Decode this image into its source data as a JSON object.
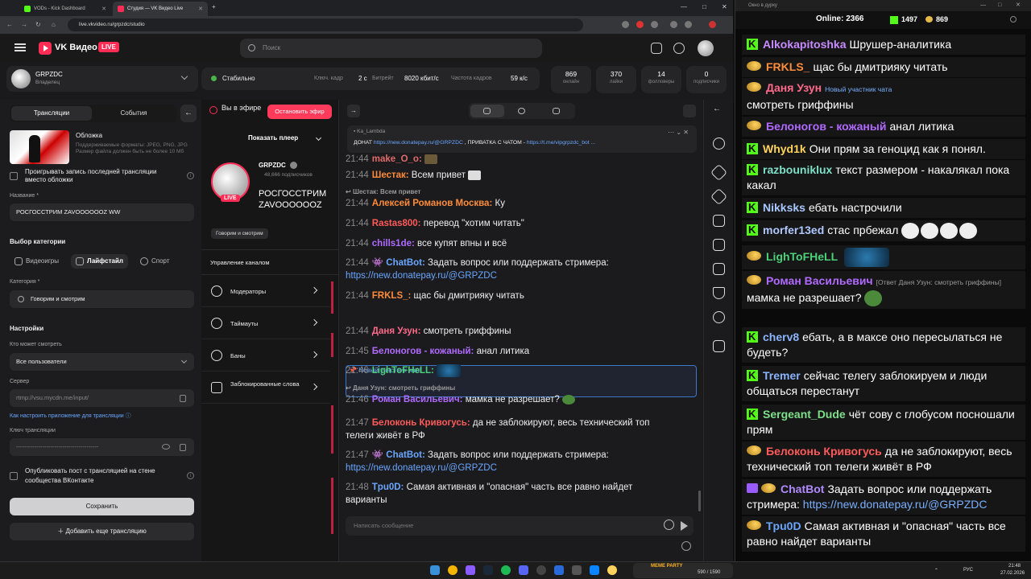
{
  "browser": {
    "tabs": [
      {
        "label": "VODs - Kick Dashboard"
      },
      {
        "label": "Студия — VK Видео Live"
      }
    ],
    "url": "live.vkvideo.ru/grpzdc/studio"
  },
  "header": {
    "logo_text": "VK Видео",
    "live_badge": "LIVE",
    "search_placeholder": "Поиск"
  },
  "channel": {
    "name": "GRPZDC",
    "role": "Владелец"
  },
  "left": {
    "tab_streams": "Трансляции",
    "tab_events": "События",
    "cover_label": "Обложка",
    "cover_hint": "Поддерживаемые форматы: JPEG, PNG, JPG Размер файла должен быть не более 10 Мб",
    "play_last_label": "Проигрывать запись последней трансляции вместо обложки",
    "title_label": "Название *",
    "title_value": "РОСГОССТРИМ ZAVOOOOOOZ WW",
    "category_choice_label": "Выбор категории",
    "cat_games": "Видеоигры",
    "cat_lifestyle": "Лайфстайл",
    "cat_sport": "Спорт",
    "category_label": "Категория *",
    "category_value": "Говорим и смотрим",
    "settings_label": "Настройки",
    "who_watch_label": "Кто может смотреть",
    "who_watch_value": "Все пользователи",
    "server_label": "Сервер",
    "server_value": "rtmp://vsu.mycdn.me/input/",
    "help_link": "Как настроить приложение для трансляции",
    "key_label": "Ключ трансляции",
    "key_value": "-----------------------------------------",
    "publish_label": "Опубликовать пост с трансляцией на стене сообщества ВКонтакте",
    "save_button": "Сохранить",
    "add_button": "Добавить еще трансляцию"
  },
  "status": {
    "state": "Стабильно",
    "keyframe_label": "Ключ. кадр",
    "keyframe_value": "2 с",
    "bitrate_label": "Битрейт",
    "bitrate_value": "8020 кбит/с",
    "fps_label": "Частота кадров",
    "fps_value": "59 к/с"
  },
  "stats": [
    {
      "value": "869",
      "label": "онлайн"
    },
    {
      "value": "370",
      "label": "лайки"
    },
    {
      "value": "14",
      "label": "фолловеры"
    },
    {
      "value": "0",
      "label": "подписчики"
    }
  ],
  "stream": {
    "on_air": "Вы в эфире",
    "stop_button": "Остановить эфир",
    "show_player": "Показать плеер",
    "channel_name": "GRPZDC",
    "subscribers": "48,666 подписчиков",
    "live_badge": "LIVE",
    "title": "РОСГОССТРИМ ZAVOOOOOOZ WW",
    "category": "Говорим и смотрим",
    "manage_header": "Управление каналом",
    "manage_items": [
      "Модераторы",
      "Таймауты",
      "Баны",
      "Заблокированные слова"
    ]
  },
  "chat": {
    "pinned_user": "Ka_Lambda",
    "pinned_prefix": "ДОНАТ ",
    "pinned_link1": "https://new.donatepay.ru/@GRPZDC",
    "pinned_mid": " , ПРИВАТКА С ЧАТОМ - ",
    "pinned_link2": "https://t.me/vipgrpzdc_bot ...",
    "input_placeholder": "Написать сообщение",
    "new_member_label": "Новый участник чата",
    "messages": [
      {
        "time": "21:44",
        "user": "make_O_o:",
        "color": "#e06a6a",
        "text": ""
      },
      {
        "time": "21:44",
        "user": "Шестак:",
        "color": "#ff8c3a",
        "text": "Всем привет"
      },
      {
        "reply": "Шестак: Всем привет"
      },
      {
        "time": "21:44",
        "user": "Алексей Романов Москва:",
        "color": "#ff8c3a",
        "text": "Ку"
      },
      {
        "time": "21:44",
        "user": "Rastas800:",
        "color": "#ff5a5a",
        "text": "перевод \"хотим читать\""
      },
      {
        "time": "21:44",
        "user": "chills1de:",
        "color": "#b06aff",
        "text": "все купят впны и всё"
      },
      {
        "time": "21:44",
        "user": "ChatBot:",
        "color": "#6aa6ff",
        "text": "Задать вопрос или поддержать стримера:",
        "link": "https://new.donatepay.ru/@GRPZDC"
      },
      {
        "time": "21:44",
        "user": "FRKLS_:",
        "color": "#ff8c3a",
        "text": "щас бы дмитрияку читать"
      },
      {
        "time": "21:44",
        "user": "Даня Узун:",
        "color": "#ff6a8a",
        "text": "смотреть гриффины"
      },
      {
        "time": "21:45",
        "user": "Белоногов - кожаный:",
        "color": "#b06aff",
        "text": "анал литика"
      },
      {
        "time": "21:46",
        "user": "LighToFHeLL:",
        "color": "#4bd17a",
        "text": ""
      },
      {
        "reply": "Даня Узун: смотреть гриффины"
      },
      {
        "time": "21:46",
        "user": "Роман Васильевич:",
        "color": "#b06aff",
        "text": "мамка не разрешает?"
      },
      {
        "time": "21:47",
        "user": "Белоконь Кривогусь:",
        "color": "#ff5a5a",
        "text": "да не заблокируют, весь технический топ телеги живёт в РФ"
      },
      {
        "time": "21:47",
        "user": "ChatBot:",
        "color": "#6aa6ff",
        "text": "Задать вопрос или поддержать стримера:",
        "link": "https://new.donatepay.ru/@GRPZDC"
      },
      {
        "time": "21:48",
        "user": "Tpu0D:",
        "color": "#6aa6ff",
        "text": "Самая активная и \"опасная\" часть все равно найдет варианты"
      }
    ]
  },
  "obs": {
    "window_title": "Окно в дурку",
    "online_label": "Online:",
    "online_value": "2366",
    "kick_value": "1497",
    "vk_value": "869",
    "messages": [
      {
        "src": "kick",
        "user": "Alkokapitoshka",
        "color": "#c78cff",
        "text": "Шрушер-аналитика"
      },
      {
        "src": "vk",
        "user": "FRKLS_",
        "color": "#ff8c3a",
        "text": "щас бы дмитрияку читать"
      },
      {
        "src": "vk",
        "user": "Даня Узун",
        "color": "#ff6a8a",
        "badge": "Новый участник чата",
        "text": "смотреть гриффины"
      },
      {
        "src": "vk",
        "user": "Белоногов - кожаный",
        "color": "#b06aff",
        "text": "анал литика"
      },
      {
        "src": "kick",
        "user": "Whyd1k",
        "color": "#ffd35e",
        "text": "Они прям за геноцид как я понял."
      },
      {
        "src": "kick",
        "user": "razbouniklux",
        "color": "#7ee0c8",
        "text": "текст размером - накалякал пока какал"
      },
      {
        "src": "kick",
        "user": "Nikksks",
        "color": "#a8c8ff",
        "text": "ебать настрочили"
      },
      {
        "src": "kick",
        "user": "morfer13ed",
        "color": "#b0c8ff",
        "text": "стас прбежал"
      },
      {
        "src": "vk",
        "user": "LighToFHeLL",
        "color": "#4bd17a",
        "text": ""
      },
      {
        "src": "vk",
        "user": "Роман Васильевич",
        "color": "#b06aff",
        "reply": "[Ответ Даня Узун: смотреть гриффины]",
        "text": "мамка не разрешает?"
      },
      {
        "src": "kick",
        "user": "cherv8",
        "color": "#8ab4ff",
        "text": "ебать, а в максе оно пересылаться не будеть?"
      },
      {
        "src": "kick",
        "user": "Tremer",
        "color": "#8ab4ff",
        "text": "сейчас телегу заблокируем и люди общаться перестанут"
      },
      {
        "src": "kick",
        "user": "Sergeant_Dude",
        "color": "#7ee08a",
        "text": "чёт сову с глобусом посношали прям"
      },
      {
        "src": "vk",
        "user": "Белоконь Кривогусь",
        "color": "#ff5a5a",
        "text": "да не заблокируют, весь технический топ телеги живёт в РФ"
      },
      {
        "src": "vk",
        "user": "ChatBot",
        "color": "#b08aff",
        "bot": true,
        "text": "Задать вопрос или поддержать стримера:",
        "link": "https://new.donatepay.ru/@GRPZDC"
      },
      {
        "src": "vk",
        "user": "Tpu0D",
        "color": "#6aa6ff",
        "text": "Самая активная и \"опасная\" часть все равно найдет варианты"
      }
    ]
  },
  "taskbar": {
    "lang": "РУС",
    "time": "21:48",
    "date": "27.02.2026",
    "meme_title": "MEME PARTY",
    "meme_count": "590 / 1590"
  }
}
